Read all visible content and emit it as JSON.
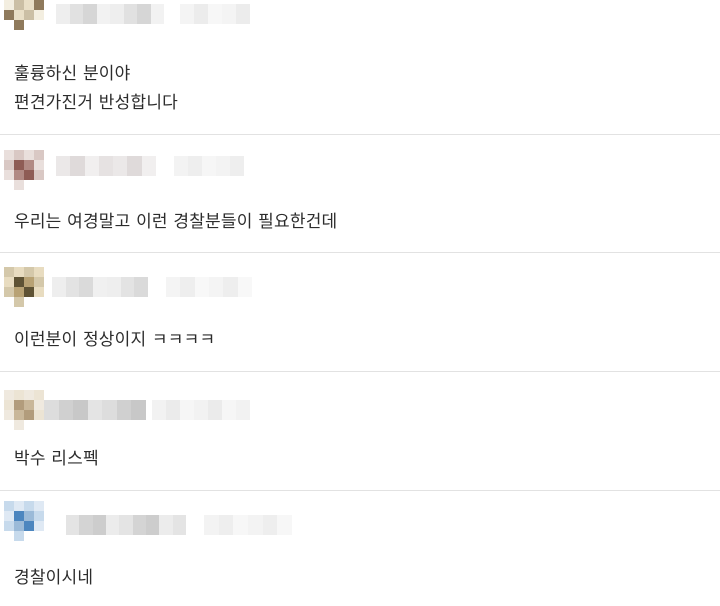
{
  "comments": [
    {
      "author_name": "",
      "lines": [
        "훌륭하신 분이야",
        "편견가진거 반성합니다"
      ],
      "avatar_palette": [
        "#f3eee0",
        "#e9dfc7",
        "#cbbfa5",
        "#8f7a5c",
        "#a5987d"
      ],
      "name_palette": [
        "#eeeeee",
        "#e1e1e1",
        "#d6d6d6",
        "#f2f2f2"
      ],
      "meta_palette": [
        "#f4f4f4",
        "#ececec",
        "#f7f7f7"
      ]
    },
    {
      "author_name": "",
      "lines": [
        "우리는 여경말고 이런 경찰분들이 필요한건데"
      ],
      "avatar_palette": [
        "#d9c8c4",
        "#b18a84",
        "#8e5c55",
        "#e9dfdc",
        "#c7b3ae"
      ],
      "name_palette": [
        "#ebe8e8",
        "#dfdada",
        "#f1efef",
        "#e6e2e2"
      ],
      "meta_palette": [
        "#f3f3f3",
        "#eeeeee",
        "#f6f6f6"
      ]
    },
    {
      "author_name": "",
      "lines": [
        "이런분이 정상이지 ㅋㅋㅋㅋ"
      ],
      "avatar_palette": [
        "#e8dcc0",
        "#b8a274",
        "#5f5335",
        "#d4c8aa",
        "#efe8d8"
      ],
      "name_palette": [
        "#eeeeee",
        "#e3e3e3",
        "#dadada",
        "#f0f0f0"
      ],
      "meta_palette": [
        "#f4f4f4",
        "#eeeeee",
        "#f8f8f8"
      ]
    },
    {
      "author_name": "",
      "lines": [
        "박수 리스펙"
      ],
      "avatar_palette": [
        "#ece4d4",
        "#c9b79a",
        "#b29c7c",
        "#efe9df",
        "#d8ccb6"
      ],
      "name_palette": [
        "#dddddd",
        "#d0d0d0",
        "#c8c8c8",
        "#e4e4e4"
      ],
      "meta_palette": [
        "#f2f2f2",
        "#ebebeb",
        "#f6f6f6"
      ]
    },
    {
      "author_name": "",
      "lines": [
        "경찰이시네"
      ],
      "avatar_palette": [
        "#dfe9f4",
        "#9bbad8",
        "#4c86bf",
        "#c7daec",
        "#eef3f8"
      ],
      "name_palette": [
        "#e4e4e4",
        "#d4d4d4",
        "#cdcdcd",
        "#ececec"
      ],
      "meta_palette": [
        "#f3f3f3",
        "#eeeeee",
        "#f7f7f7"
      ]
    }
  ]
}
